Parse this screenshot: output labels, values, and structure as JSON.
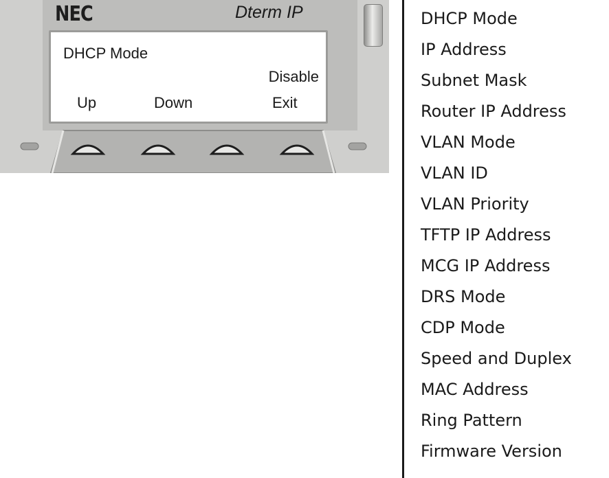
{
  "phone": {
    "logo": "NEC",
    "model": "Dterm IP",
    "display": {
      "title": "DHCP Mode",
      "value": "Disable",
      "softkeys": [
        "Up",
        "Down",
        "Exit"
      ]
    }
  },
  "menu": {
    "items": [
      "DHCP Mode",
      "IP Address",
      "Subnet Mask",
      "Router IP Address",
      "VLAN Mode",
      "VLAN ID",
      "VLAN Priority",
      "TFTP IP Address",
      "MCG IP Address",
      "DRS Mode",
      "CDP Mode",
      "Speed and Duplex",
      "MAC Address",
      "Ring Pattern",
      "Firmware Version"
    ]
  }
}
